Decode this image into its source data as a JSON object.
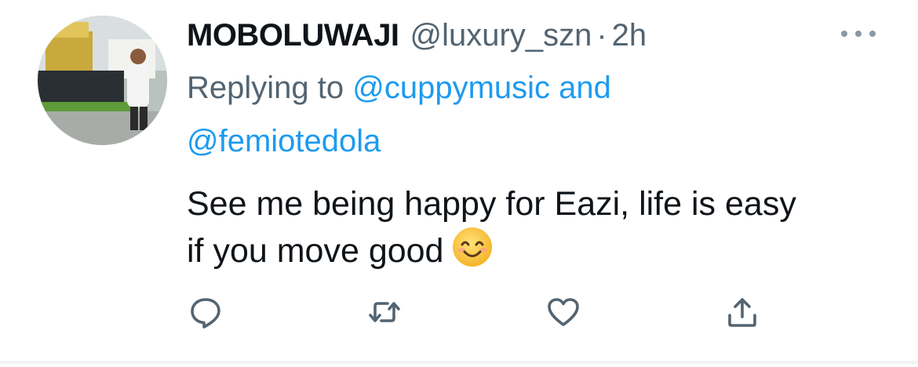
{
  "tweet": {
    "display_name": "MOBOLUWAJI",
    "handle": "@luxury_szn",
    "separator": "·",
    "time": "2h",
    "replying_prefix": "Replying to",
    "reply_mention_1": "@cuppymusic",
    "reply_and": "and",
    "reply_mention_2": "@femiotedola",
    "body_line_1": "See me being happy for Eazi, life is easy",
    "body_line_2": "if you move good",
    "emoji": "smiling-face-with-smiling-eyes"
  },
  "actions": {
    "reply_icon": "reply-icon",
    "retweet_icon": "retweet-icon",
    "like_icon": "heart-icon",
    "share_icon": "share-icon"
  },
  "colors": {
    "text": "#0f1419",
    "secondary": "#536471",
    "link": "#1d9bf0",
    "icon": "#536471",
    "divider": "#eff3f4"
  }
}
